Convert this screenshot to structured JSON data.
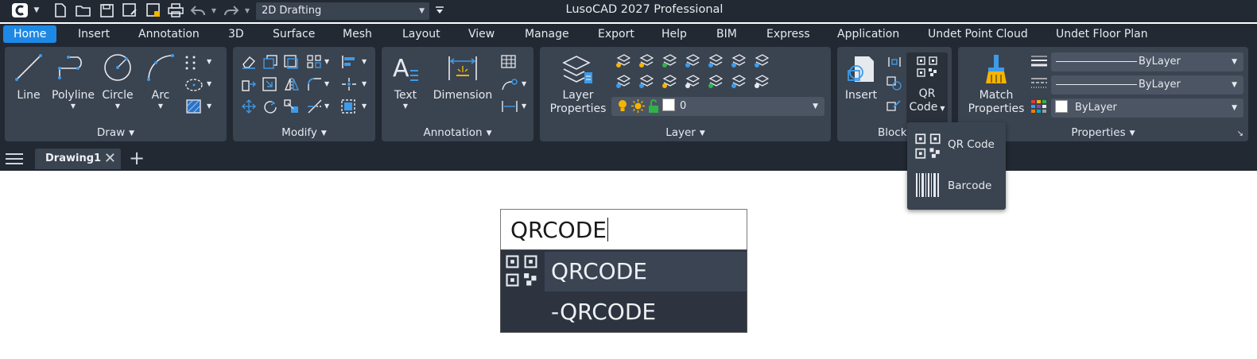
{
  "title": "LusoCAD 2027 Professional",
  "workspace": {
    "value": "2D Drafting"
  },
  "tabs": [
    "Home",
    "Insert",
    "Annotation",
    "3D",
    "Surface",
    "Mesh",
    "Layout",
    "View",
    "Manage",
    "Export",
    "Help",
    "BIM",
    "Express",
    "Application",
    "Undet Point Cloud",
    "Undet Floor Plan"
  ],
  "draw": {
    "title": "Draw",
    "line": "Line",
    "polyline": "Polyline",
    "circle": "Circle",
    "arc": "Arc"
  },
  "modify": {
    "title": "Modify"
  },
  "annotation": {
    "title": "Annotation",
    "text": "Text",
    "dimension": "Dimension"
  },
  "layer": {
    "title": "Layer",
    "props1": "Layer",
    "props2": "Properties",
    "current": "0"
  },
  "block": {
    "title": "Block",
    "insert": "Insert",
    "qr1": "QR",
    "qr2": "Code"
  },
  "properties": {
    "title": "Properties",
    "match1": "Match",
    "match2": "Properties",
    "lineweight": "ByLayer",
    "linetype": "ByLayer",
    "color": "ByLayer"
  },
  "document": {
    "tab": "Drawing1"
  },
  "qr_menu": {
    "qr": "QR Code",
    "barcode": "Barcode"
  },
  "command": {
    "input": "QRCODE",
    "suggestions": [
      "QRCODE",
      "-QRCODE"
    ]
  },
  "colors": {
    "accent": "#1e88e5",
    "panel": "#3a4350",
    "ribbon": "#222933",
    "icon_blue": "#3d9be9",
    "icon_yellow": "#f5b400",
    "icon_green": "#2fb24a"
  }
}
